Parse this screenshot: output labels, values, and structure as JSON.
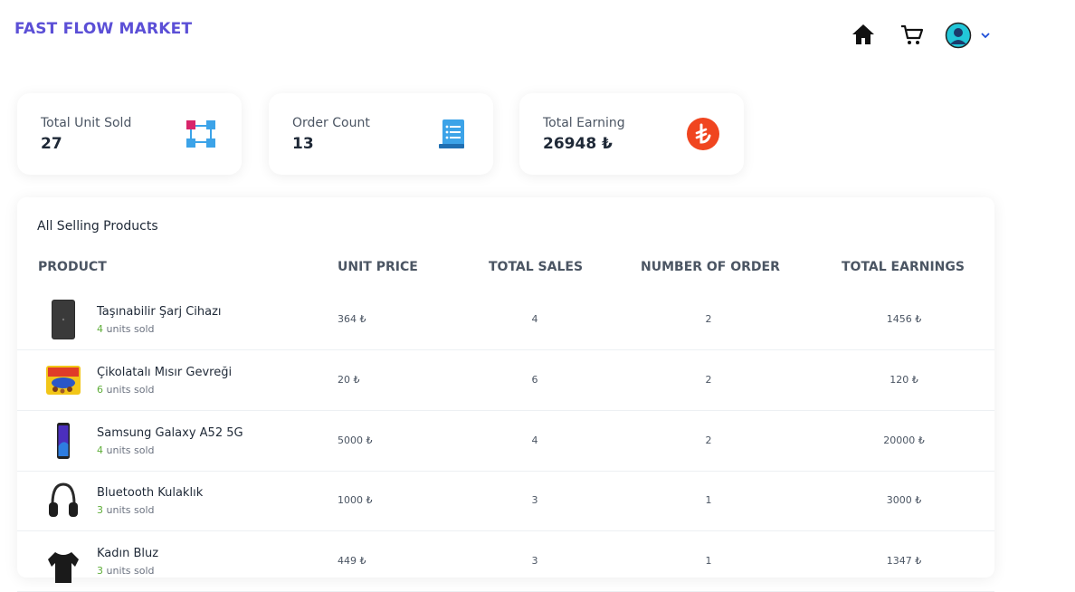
{
  "app": {
    "brand": "FAST FLOW MARKET"
  },
  "nav": {
    "icons": [
      "home-icon",
      "cart-icon",
      "user-avatar-icon",
      "chevron-down-icon"
    ],
    "accent": "#5b4fd6"
  },
  "stats": [
    {
      "label": "Total Unit Sold",
      "value": "27",
      "icon": "nodes-icon"
    },
    {
      "label": "Order Count",
      "value": "13",
      "icon": "receipt-list-icon"
    },
    {
      "label": "Total Earning",
      "value": "26948 ₺",
      "icon": "lira-coin-icon"
    }
  ],
  "table": {
    "title": "All Selling Products",
    "columns": [
      "PRODUCT",
      "UNIT PRICE",
      "TOTAL SALES",
      "NUMBER OF ORDER",
      "TOTAL EARNINGS"
    ],
    "sold_suffix": " units sold",
    "rows": [
      {
        "name": "Taşınabilir Şarj Cihazı",
        "sold": "4",
        "price": "364 ₺",
        "sales": "4",
        "orders": "2",
        "earnings": "1456 ₺",
        "thumb": "powerbank-thumb"
      },
      {
        "name": "Çikolatalı Mısır Gevreği",
        "sold": "6",
        "price": "20 ₺",
        "sales": "6",
        "orders": "2",
        "earnings": "120 ₺",
        "thumb": "cereal-thumb"
      },
      {
        "name": "Samsung Galaxy A52 5G",
        "sold": "4",
        "price": "5000 ₺",
        "sales": "4",
        "orders": "2",
        "earnings": "20000 ₺",
        "thumb": "phone-thumb"
      },
      {
        "name": "Bluetooth Kulaklık",
        "sold": "3",
        "price": "1000 ₺",
        "sales": "3",
        "orders": "1",
        "earnings": "3000 ₺",
        "thumb": "headphones-thumb"
      },
      {
        "name": "Kadın Bluz",
        "sold": "3",
        "price": "449 ₺",
        "sales": "3",
        "orders": "1",
        "earnings": "1347 ₺",
        "thumb": "blouse-thumb"
      }
    ]
  }
}
